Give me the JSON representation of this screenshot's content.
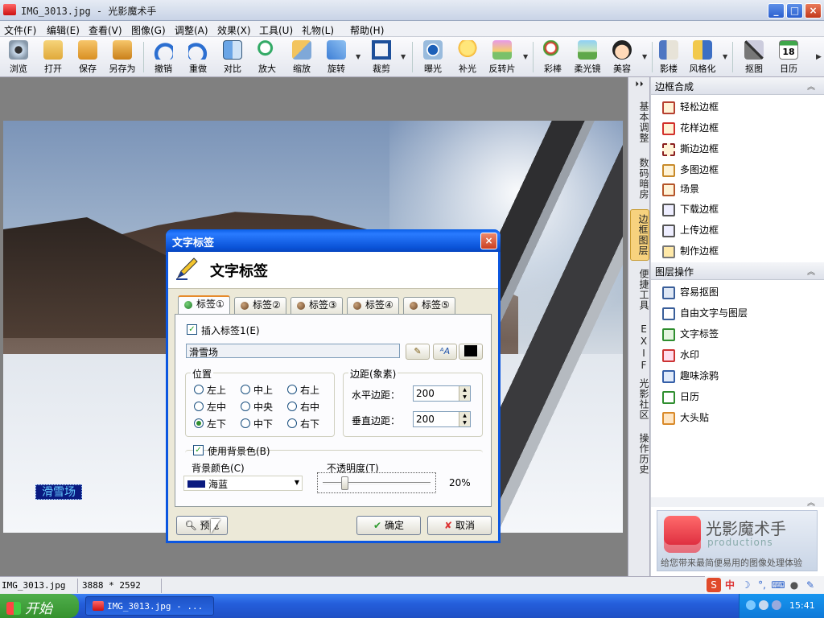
{
  "window": {
    "title": "IMG_3013.jpg - 光影魔术手",
    "minimize": "_",
    "maximize": "□",
    "close": "×"
  },
  "menu": [
    "文件(F)",
    "编辑(E)",
    "查看(V)",
    "图像(G)",
    "调整(A)",
    "效果(X)",
    "工具(U)",
    "礼物(L)",
    "帮助(H)"
  ],
  "toolbar": [
    "浏览",
    "打开",
    "保存",
    "另存为",
    "撤销",
    "重做",
    "对比",
    "放大",
    "缩放",
    "旋转",
    "裁剪",
    "曝光",
    "补光",
    "反转片",
    "彩棒",
    "柔光镜",
    "美容",
    "影楼",
    "风格化",
    "抠图",
    "日历"
  ],
  "calendar_day": "18",
  "side_tabs": [
    "基本调整",
    "数码暗房",
    "边框图层",
    "便捷工具",
    "EXIF",
    "光影社区",
    "操作历史"
  ],
  "panel": {
    "frame_header": "边框合成",
    "frame_items": [
      "轻松边框",
      "花样边框",
      "撕边边框",
      "多图边框",
      "场景",
      "下载边框",
      "上传边框",
      "制作边框"
    ],
    "layer_header": "图层操作",
    "layer_items": [
      "容易抠图",
      "自由文字与图层",
      "文字标签",
      "水印",
      "趣味涂鸦",
      "日历",
      "大头贴"
    ]
  },
  "promo": {
    "name": "光影魔术手",
    "sub": "productions",
    "slogan": "给您带来最简便易用的图像处理体验"
  },
  "photo_tag": "滑雪场",
  "dialog": {
    "title": "文字标签",
    "header": "文字标签",
    "tabs": [
      "标签①",
      "标签②",
      "标签③",
      "标签④",
      "标签⑤"
    ],
    "insert_label": "插入标签1(E)",
    "text_value": "滑雪场",
    "position_title": "位置",
    "positions": [
      "左上",
      "中上",
      "右上",
      "左中",
      "中央",
      "右中",
      "左下",
      "中下",
      "右下"
    ],
    "selected_position": "左下",
    "margin_title": "边距(象素)",
    "h_margin_label": "水平边距：",
    "h_margin": "200",
    "v_margin_label": "垂直边距：",
    "v_margin": "200",
    "use_bg_label": "使用背景色(B)",
    "bg_color_label": "背景颜色(C)",
    "bg_color_value": "海蓝",
    "opacity_label": "不透明度(T)",
    "opacity_value": "20%",
    "opacity_fraction": 0.2,
    "preview": "预览",
    "ok": "确定",
    "cancel": "取消",
    "close": "×"
  },
  "status": {
    "filename": "IMG_3013.jpg",
    "dimensions": "3888 * 2592"
  },
  "taskbar": {
    "start": "开始",
    "item": "IMG_3013.jpg - ...",
    "clock": "15:41"
  },
  "ime": {
    "lang": "中"
  },
  "colors": {
    "accent": "#0b56e0",
    "tag_bg": "#0a1a80",
    "tag_text": "#66ccff"
  }
}
